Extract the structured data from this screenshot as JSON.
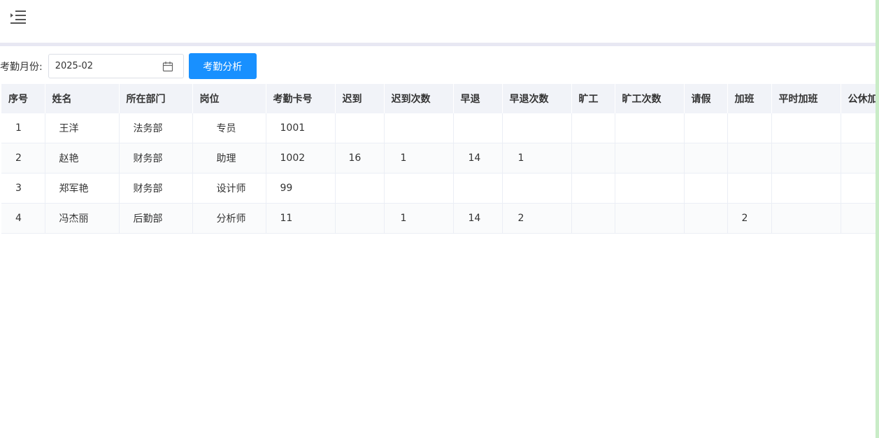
{
  "header": {
    "menu_icon": "indent-menu-icon"
  },
  "filter": {
    "label": "考勤月份:",
    "month_value": "2025-02",
    "calendar_icon": "calendar-icon",
    "analyze_label": "考勤分析"
  },
  "table": {
    "columns": [
      "序号",
      "姓名",
      "所在部门",
      "岗位",
      "考勤卡号",
      "迟到",
      "迟到次数",
      "早退",
      "早退次数",
      "旷工",
      "旷工次数",
      "请假",
      "加班",
      "平时加班",
      "公休加"
    ],
    "rows": [
      [
        "1",
        "王洋",
        "法务部",
        "专员",
        "1001",
        "",
        "",
        "",
        "",
        "",
        "",
        "",
        "",
        "",
        ""
      ],
      [
        "2",
        "赵艳",
        "财务部",
        "助理",
        "1002",
        "16",
        "1",
        "14",
        "1",
        "",
        "",
        "",
        "",
        "",
        ""
      ],
      [
        "3",
        "郑军艳",
        "财务部",
        "设计师",
        "99",
        "",
        "",
        "",
        "",
        "",
        "",
        "",
        "",
        "",
        ""
      ],
      [
        "4",
        "冯杰丽",
        "后勤部",
        "分析师",
        "11",
        "",
        "1",
        "14",
        "2",
        "",
        "",
        "",
        "2",
        "",
        ""
      ]
    ]
  },
  "colors": {
    "primary": "#1890ff",
    "header_bg": "#f1f3f8",
    "divider": "#e8e8f3"
  }
}
